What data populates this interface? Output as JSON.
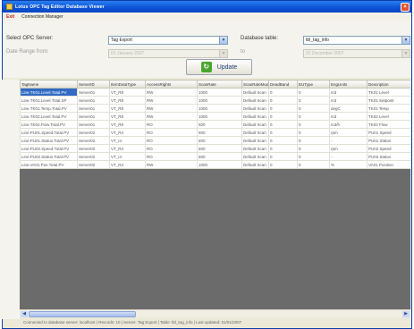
{
  "window": {
    "title": "Lotus OPC Tag Editor Database Viewer",
    "close_label": "×"
  },
  "menu": [
    "Exit",
    "Connection Manager"
  ],
  "form": {
    "server_label": "Select OPC Server:",
    "server_value": "Tag Export",
    "database_label": "Database table:",
    "database_value": "tbl_tag_info",
    "date_label": "Date Range from:",
    "date_from": "01 January 2007",
    "to_label": "to",
    "date_to": "31 December 2007",
    "update_label": "Update"
  },
  "table": {
    "columns": [
      "TagName",
      "ServerID",
      "ItemDataType",
      "AccessRights",
      "ScanRate",
      "ScanRateMode",
      "DeadBand",
      "EUType",
      "EngUnits",
      "Description"
    ],
    "rows": [
      [
        "Line.TK01.Level.Total.PV",
        "Server01",
        "VT_R8",
        "RW",
        "1000",
        "Default Scan",
        "0",
        "0",
        "m3",
        "TK01 Level"
      ],
      [
        "Line.TK01.Level.Total.SP",
        "Server01",
        "VT_R8",
        "RW",
        "1000",
        "Default Scan",
        "0",
        "0",
        "m3",
        "TK01 Setpoint"
      ],
      [
        "Line.TK01.Temp.Total.PV",
        "Server01",
        "VT_R8",
        "RW",
        "1000",
        "Default Scan",
        "0",
        "0",
        "degC",
        "TK01 Temp"
      ],
      [
        "Line.TK02.Level.Total.PV",
        "Server01",
        "VT_R8",
        "RW",
        "1000",
        "Default Scan",
        "0",
        "0",
        "m3",
        "TK02 Level"
      ],
      [
        "Line.TK02.Flow.Total.PV",
        "Server01",
        "VT_R8",
        "RO",
        "500",
        "Default Scan",
        "0",
        "0",
        "m3/h",
        "TK02 Flow"
      ],
      [
        "Line.PU01.Speed.Total.PV",
        "Server02",
        "VT_R4",
        "RO",
        "500",
        "Default Scan",
        "0",
        "0",
        "rpm",
        "PU01 Speed"
      ],
      [
        "Line.PU01.Status.Total.PV",
        "Server02",
        "VT_I4",
        "RO",
        "500",
        "Default Scan",
        "0",
        "0",
        "-",
        "PU01 Status"
      ],
      [
        "Line.PU02.Speed.Total.PV",
        "Server02",
        "VT_R4",
        "RO",
        "500",
        "Default Scan",
        "0",
        "0",
        "rpm",
        "PU02 Speed"
      ],
      [
        "Line.PU02.Status.Total.PV",
        "Server02",
        "VT_I4",
        "RO",
        "500",
        "Default Scan",
        "0",
        "0",
        "-",
        "PU02 Status"
      ],
      [
        "Line.VA01.Pos.Total.PV",
        "Server02",
        "VT_R4",
        "RW",
        "1000",
        "Default Scan",
        "0",
        "0",
        "%",
        "VA01 Position"
      ]
    ]
  },
  "status_text": "Connected to database server: localhost  |  Records: 10  |  Server: Tag Export  |  Table: tbl_tag_info  |  Last updated: 01/01/2007"
}
